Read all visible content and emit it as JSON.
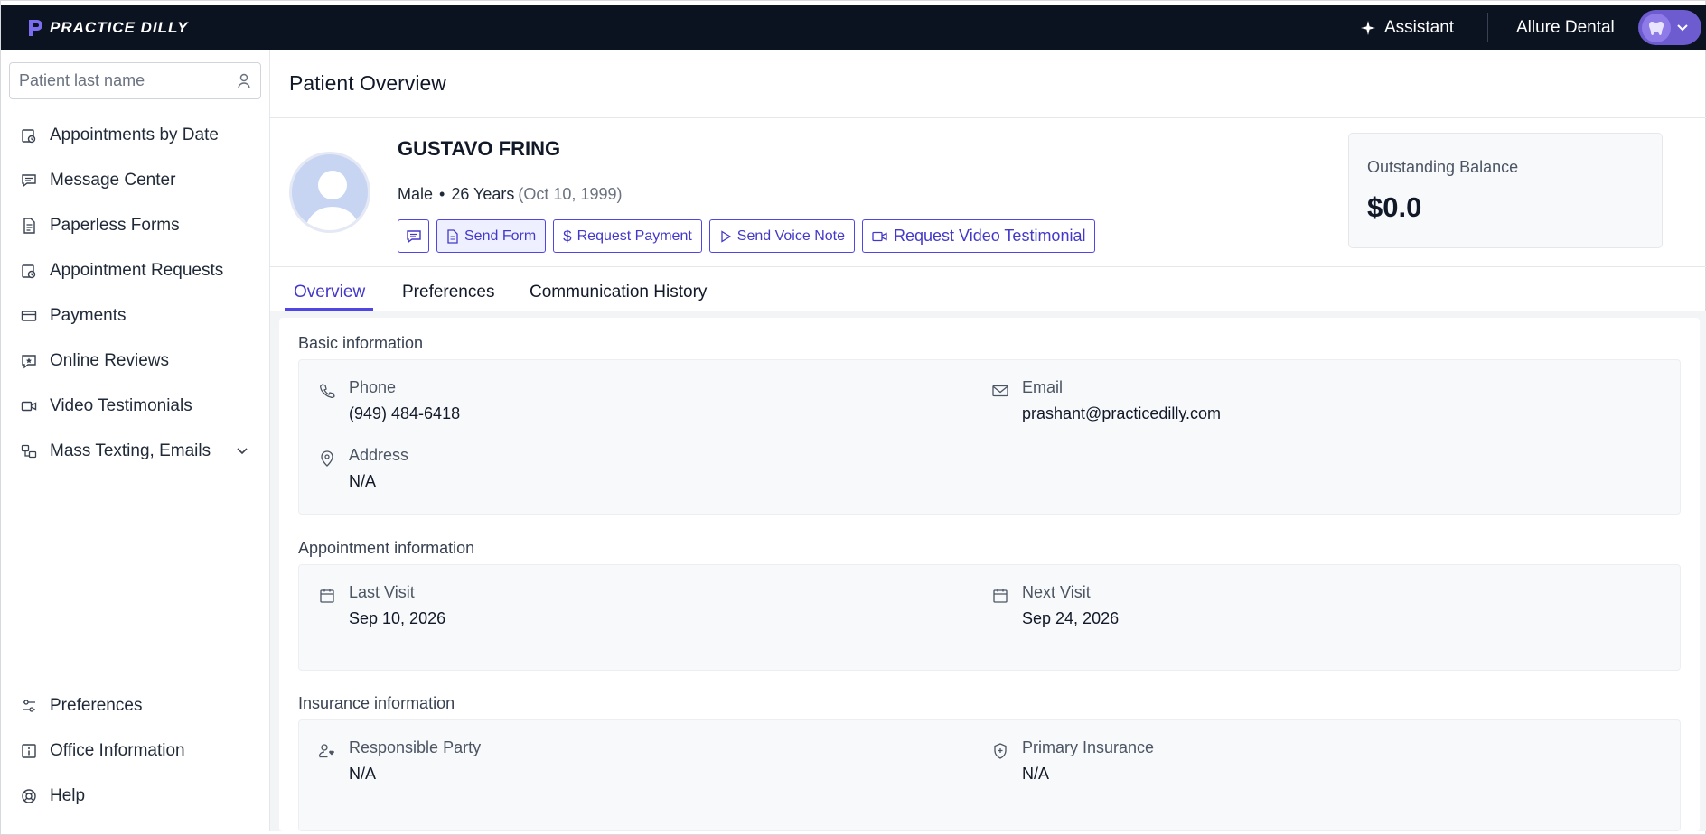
{
  "topbar": {
    "brand": "PRACTICE DILLY",
    "assistant_label": "Assistant",
    "office_name": "Allure Dental",
    "accent": "#6d5bd0"
  },
  "sidebar": {
    "search_placeholder": "Patient last name",
    "items": [
      {
        "label": "Appointments by Date",
        "icon": "calendar-clock-icon"
      },
      {
        "label": "Message Center",
        "icon": "message-icon"
      },
      {
        "label": "Paperless Forms",
        "icon": "document-icon"
      },
      {
        "label": "Appointment Requests",
        "icon": "calendar-clock-icon"
      },
      {
        "label": "Payments",
        "icon": "card-icon"
      },
      {
        "label": "Online Reviews",
        "icon": "review-icon"
      },
      {
        "label": "Video Testimonials",
        "icon": "video-icon"
      },
      {
        "label": "Mass Texting, Emails",
        "icon": "broadcast-icon"
      }
    ],
    "bottom_items": [
      {
        "label": "Preferences",
        "icon": "sliders-icon"
      },
      {
        "label": "Office Information",
        "icon": "info-icon"
      },
      {
        "label": "Help",
        "icon": "lifebuoy-icon"
      }
    ]
  },
  "main": {
    "page_title": "Patient Overview",
    "patient": {
      "name": "GUSTAVO FRING",
      "gender": "Male",
      "age": "26 Years",
      "dob": "(Oct 10, 1999)"
    },
    "actions": {
      "send_form": "Send Form",
      "request_payment": "Request Payment",
      "send_voice_note": "Send Voice Note",
      "request_video": "Request Video Testimonial"
    },
    "balance": {
      "label": "Outstanding Balance",
      "amount": "$0.0"
    },
    "tabs": [
      {
        "label": "Overview"
      },
      {
        "label": "Preferences"
      },
      {
        "label": "Communication History"
      }
    ],
    "basic": {
      "title": "Basic information",
      "phone_label": "Phone",
      "phone": "(949) 484-6418",
      "email_label": "Email",
      "email": "prashant@practicedilly.com",
      "address_label": "Address",
      "address": "N/A"
    },
    "appointment": {
      "title": "Appointment information",
      "last_label": "Last Visit",
      "last": "Sep 10, 2026",
      "next_label": "Next Visit",
      "next": "Sep 24, 2026"
    },
    "insurance": {
      "title": "Insurance information",
      "party_label": "Responsible Party",
      "party": "N/A",
      "primary_label": "Primary Insurance",
      "primary": "N/A"
    }
  }
}
